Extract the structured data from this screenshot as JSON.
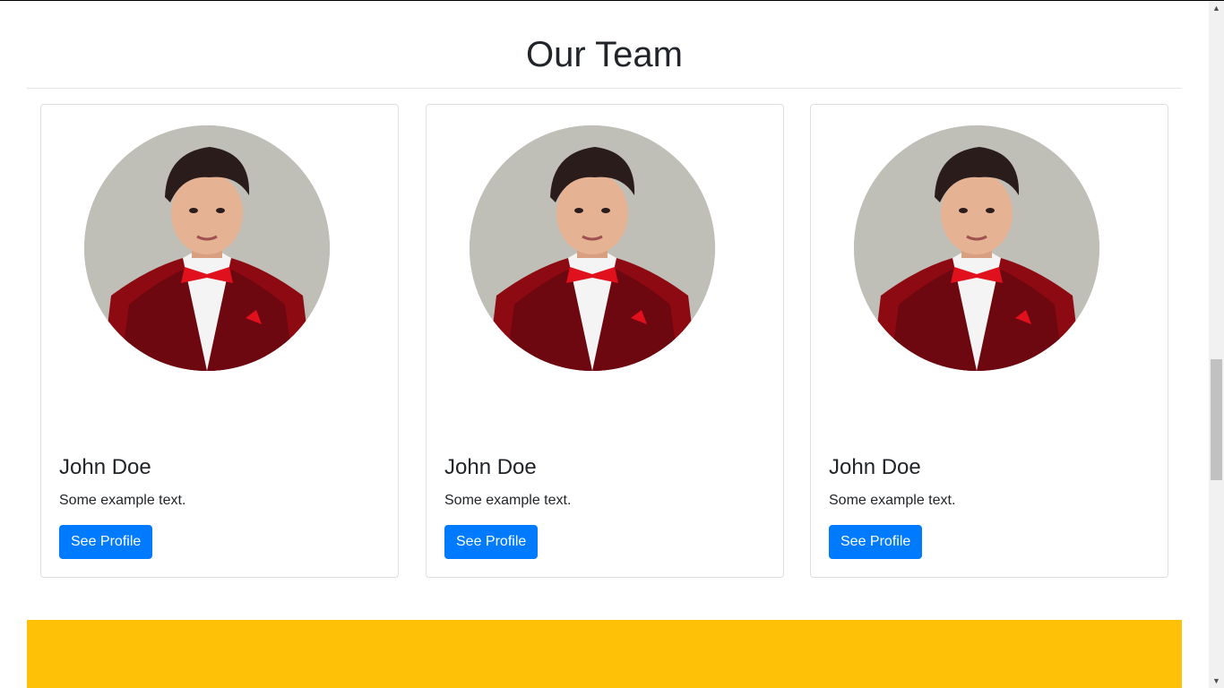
{
  "section": {
    "title": "Our Team"
  },
  "cards": [
    {
      "name": "John Doe",
      "text": "Some example text.",
      "button_label": "See Profile"
    },
    {
      "name": "John Doe",
      "text": "Some example text.",
      "button_label": "See Profile"
    },
    {
      "name": "John Doe",
      "text": "Some example text.",
      "button_label": "See Profile"
    }
  ],
  "colors": {
    "button": "#007bff",
    "footer_band": "#ffc107",
    "avatar_background": "#bfbfb8"
  },
  "icons": {
    "scroll_up": "scroll-up-arrow-icon",
    "scroll_down": "scroll-down-arrow-icon"
  }
}
